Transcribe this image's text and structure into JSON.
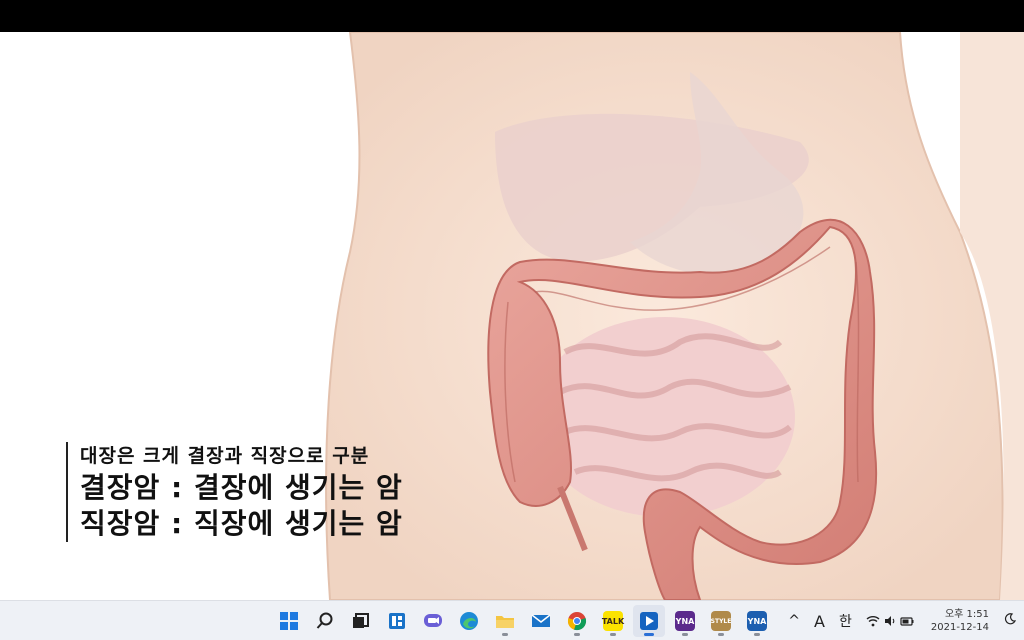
{
  "caption": {
    "line1": "대장은 크게 결장과 직장으로 구분",
    "line2": "결장암 : 결장에 생기는 암",
    "line3": "직장암 : 직장에 생기는 암"
  },
  "taskbar": {
    "apps": [
      {
        "name": "start",
        "icon": "windows-logo-icon"
      },
      {
        "name": "search",
        "icon": "search-icon"
      },
      {
        "name": "task-view",
        "icon": "task-view-icon"
      },
      {
        "name": "widgets",
        "icon": "widgets-icon"
      },
      {
        "name": "teams-chat",
        "icon": "chat-icon"
      },
      {
        "name": "edge",
        "icon": "edge-browser-icon"
      },
      {
        "name": "file-explorer",
        "icon": "folder-icon"
      },
      {
        "name": "mail",
        "icon": "mail-icon"
      },
      {
        "name": "chrome",
        "icon": "chrome-icon"
      },
      {
        "name": "kakaotalk",
        "icon": "kakaotalk-icon",
        "label": "TALK"
      },
      {
        "name": "media-player",
        "icon": "media-player-icon"
      },
      {
        "name": "yna-1",
        "icon": "yna-app-icon",
        "label": "YNA"
      },
      {
        "name": "style",
        "icon": "style-app-icon",
        "label": "STYLE"
      },
      {
        "name": "yna-2",
        "icon": "yna-app-icon",
        "label": "YNA"
      }
    ],
    "tray": {
      "chevron": "^",
      "font_indicator": "A",
      "ime": "한",
      "time": "오후 1:51",
      "date": "2021-12-14"
    }
  },
  "colors": {
    "taskbar_bg": "#eef1f6",
    "accent": "#2a6fd6",
    "colon": "#d98a84",
    "skin": "#f3e2d6"
  }
}
